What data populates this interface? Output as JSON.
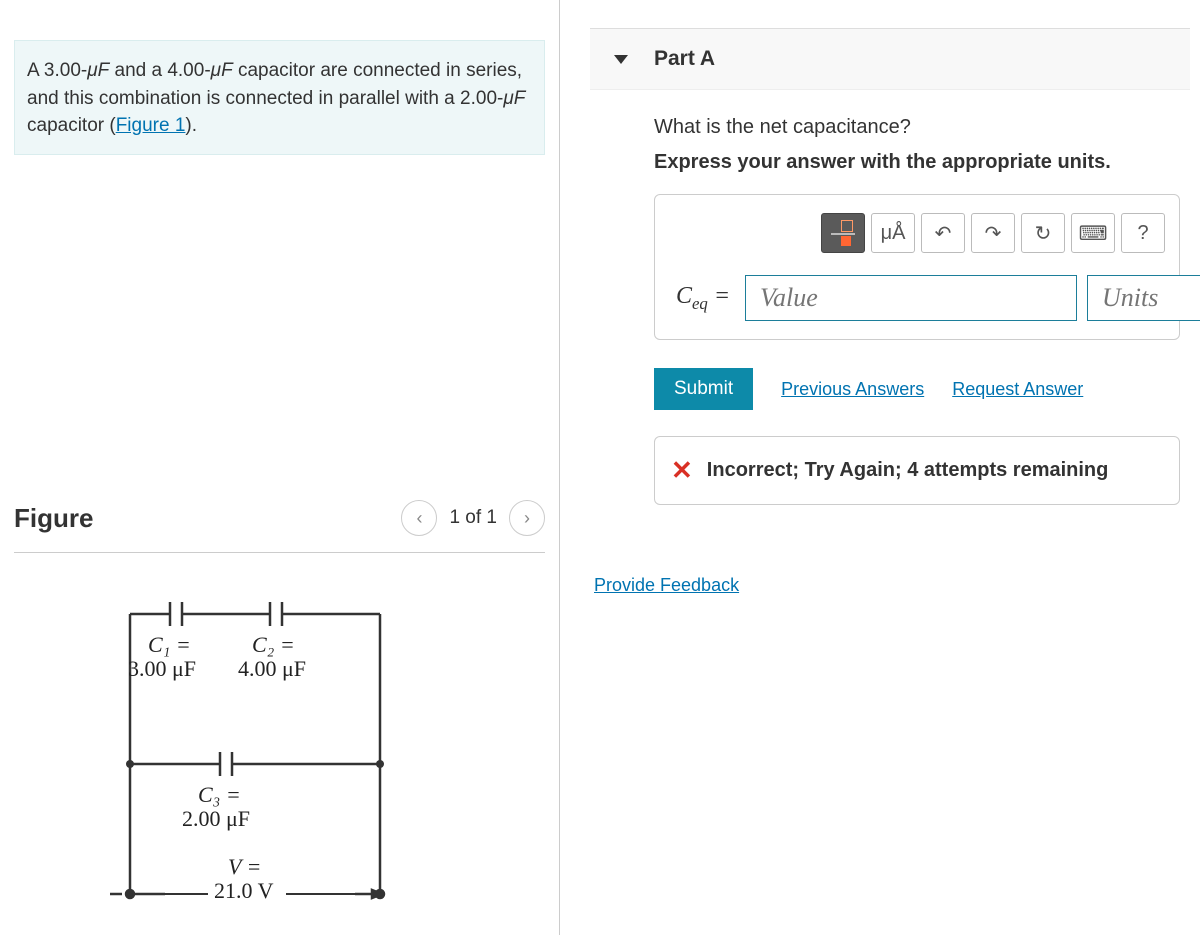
{
  "problem": {
    "text_prefix": "A 3.00-",
    "unit1": "μF",
    "text_mid1": " and a 4.00-",
    "unit2": "μF",
    "text_mid2": " capacitor are connected in series, and this combination is connected in parallel with a 2.00-",
    "unit3": "μF",
    "text_suffix": " capacitor (",
    "figure_link": "Figure 1",
    "text_end": ")."
  },
  "figure": {
    "heading": "Figure",
    "page_text": "1 of 1",
    "labels": {
      "c1_name": "C₁ =",
      "c1_val": "3.00 μF",
      "c2_name": "C₂ =",
      "c2_val": "4.00 μF",
      "c3_name": "C₃ =",
      "c3_val": "2.00 μF",
      "v_name": "V =",
      "v_val": "21.0 V"
    }
  },
  "part": {
    "title": "Part A",
    "question": "What is the net capacitance?",
    "instruction": "Express your answer with the appropriate units.",
    "toolbar": {
      "units_btn": "μÅ",
      "help_btn": "?"
    },
    "variable_label": "Cₑq =",
    "value_placeholder": "Value",
    "units_placeholder": "Units",
    "submit_label": "Submit",
    "previous_answers": "Previous Answers",
    "request_answer": "Request Answer",
    "feedback": "Incorrect; Try Again; 4 attempts remaining"
  },
  "links": {
    "provide_feedback": "Provide Feedback"
  }
}
